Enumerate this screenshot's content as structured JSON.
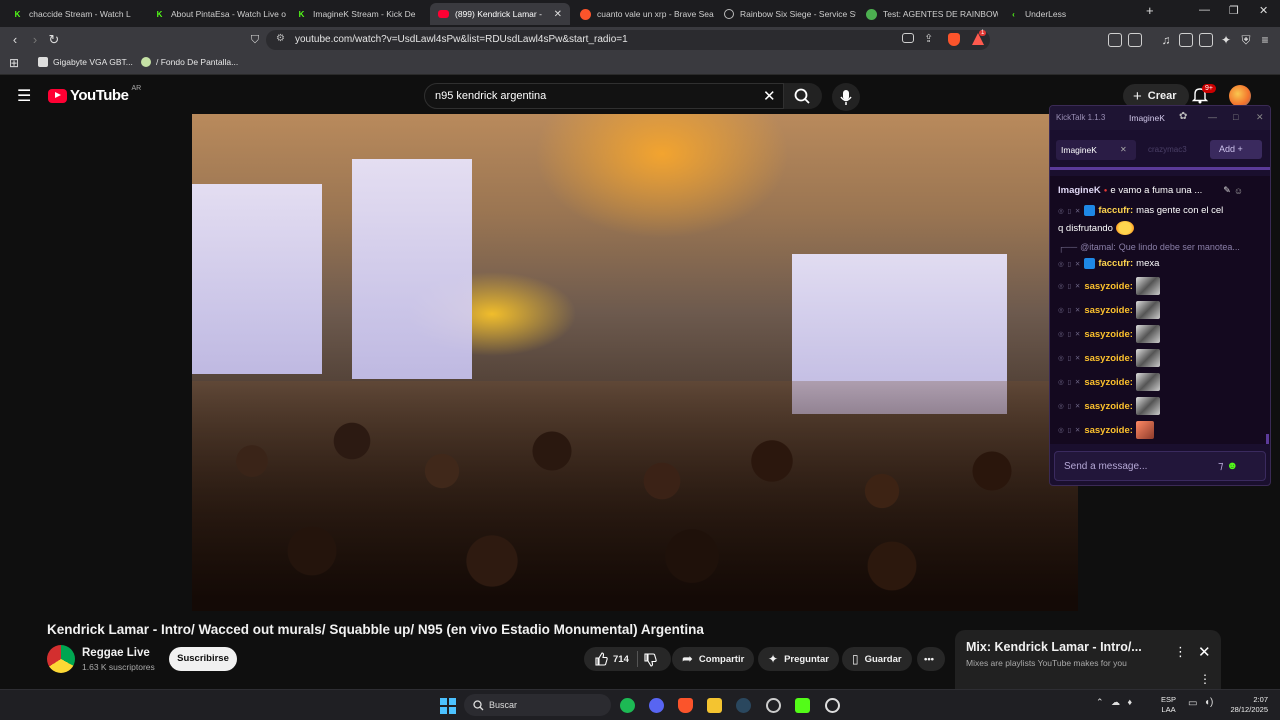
{
  "browser": {
    "tabs": [
      {
        "label": "chaccide Stream - Watch L",
        "icon": "kick-icon"
      },
      {
        "label": "About PintaEsa - Watch Live o",
        "icon": "kick-icon"
      },
      {
        "label": "ImagineK Stream - Kick De",
        "icon": "kick-icon"
      },
      {
        "label": "(899) Kendrick Lamar -",
        "icon": "youtube-icon",
        "active": true
      },
      {
        "label": "cuanto vale un xrp - Brave Sea",
        "icon": "brave-icon"
      },
      {
        "label": "Rainbow Six Siege - Service St",
        "icon": "r6-icon"
      },
      {
        "label": "Test: AGENTES DE RAINBOW S",
        "icon": "quiz-icon"
      },
      {
        "label": "UnderLess",
        "icon": "arrow-icon"
      }
    ],
    "new_tab": "+",
    "window_controls": {
      "minimize": "—",
      "maximize": "❐",
      "close": "✕"
    },
    "url": "youtube.com/watch?v=UsdLawl4sPw&list=RDUsdLawl4sPw&start_radio=1",
    "brave_shield_count": "1",
    "bookmarks": [
      {
        "label": "Gigabyte VGA GBT..."
      },
      {
        "label": "/ Fondo De Pantalla..."
      }
    ]
  },
  "youtube": {
    "logo_text": "YouTube",
    "country_code": "AR",
    "search_query": "n95 kendrick argentina",
    "create_label": "Crear",
    "notification_count": "9+",
    "video_title": "Kendrick Lamar - Intro/ Wacced out murals/ Squabble up/ N95 (en vivo Estadio Monumental) Argentina",
    "channel_name": "Reggae Live",
    "channel_subs": "1.63 K suscriptores",
    "subscribe_label": "Suscribirse",
    "like_count": "714",
    "share_label": "Compartir",
    "ask_label": "Preguntar",
    "save_label": "Guardar",
    "mix_title": "Mix: Kendrick Lamar - Intro/...",
    "mix_subtitle": "Mixes are playlists YouTube makes for you"
  },
  "kicktalk": {
    "version": "KickTalk 1.1.3",
    "username": "ImagineK",
    "tabs": [
      {
        "label": "ImagineK"
      },
      {
        "label": "crazymac3"
      }
    ],
    "add_label": "Add +",
    "messages": [
      {
        "user": "ImagineK",
        "text": "e vamo a fuma una ..."
      },
      {
        "user": "faccufr:",
        "text": "mas gente con el cel"
      },
      {
        "user": "",
        "text": "q disfrutando"
      },
      {
        "user": "@itamal:",
        "text": "Que lindo debe ser manotea..."
      },
      {
        "user": "faccufr:",
        "text": "mexa"
      },
      {
        "user": "sasyzoide:",
        "text": ""
      },
      {
        "user": "sasyzoide:",
        "text": ""
      },
      {
        "user": "sasyzoide:",
        "text": ""
      },
      {
        "user": "sasyzoide:",
        "text": ""
      },
      {
        "user": "sasyzoide:",
        "text": ""
      },
      {
        "user": "sasyzoide:",
        "text": ""
      },
      {
        "user": "sasyzoide:",
        "text": ""
      }
    ],
    "input_placeholder": "Send a message..."
  },
  "taskbar": {
    "search_placeholder": "Buscar",
    "language": "ESP",
    "language_sub": "LAA",
    "time": "2:07",
    "date": "28/12/2025"
  },
  "colors": {
    "youtube_red": "#ff0033",
    "kick_green": "#53fc18",
    "kicktalk_purple": "#5b3a99",
    "faccufr_name": "#ffd54f",
    "sasyzoide_name": "#fbc02d"
  }
}
